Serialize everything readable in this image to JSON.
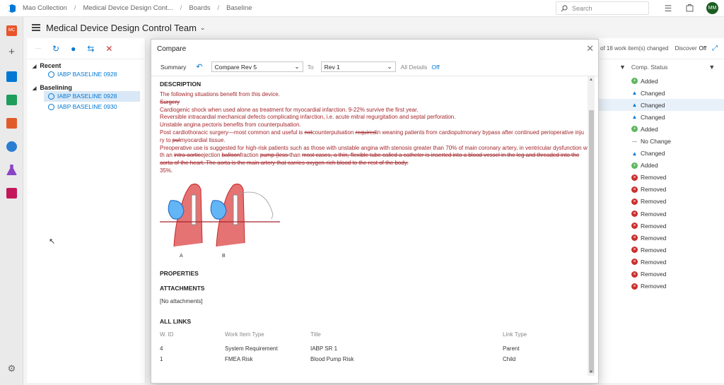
{
  "breadcrumbs": [
    "Mao Collection",
    "Medical Device Design Cont...",
    "Boards",
    "Baseline"
  ],
  "search_placeholder": "Search",
  "avatar": "MM",
  "rail_org_badge": "MC",
  "team_title": "Medical Device Design Control Team",
  "tree": {
    "recent_label": "Recent",
    "recent_items": [
      "IABP BASELINE 0928"
    ],
    "baselining_label": "Baselining",
    "baselining_items": [
      "IABP BASELINE 0928",
      "IABP BASELINE 0930"
    ]
  },
  "right_panel": {
    "summary": "of 18 work item(s) changed",
    "discover_label": "Discover",
    "discover_value": "Off",
    "col_header": "Comp. Status",
    "statuses": [
      "Added",
      "Changed",
      "Changed",
      "Changed",
      "Added",
      "No Change",
      "Changed",
      "Added",
      "Removed",
      "Removed",
      "Removed",
      "Removed",
      "Removed",
      "Removed",
      "Removed",
      "Removed",
      "Removed",
      "Removed"
    ]
  },
  "dialog": {
    "title": "Compare",
    "summary_tab": "Summary",
    "from_value": "Compare Rev 5",
    "to_label": "To",
    "to_value": "Rev 1",
    "all_details_label": "All Details",
    "all_details_value": "Off",
    "description_header": "DESCRIPTION",
    "desc_lines": {
      "l1": "The following situations benefit from this device.",
      "l2": "Surgery",
      "l3": "Cardiogenic shock when used alone as treatment for myocardial infarction. 9-22% survive the first year.",
      "l4": "Reversible intracardial mechanical defects complicating infarction, i.e. acute mitral regurgitation and septal perforation.",
      "l5": "Unstable angina pectoris benefits from counterpulsation.",
      "l6a": "Post cardiothoracic surgery—most common and useful is ",
      "l6b": "not",
      "l6c": "counterpulsation ",
      "l6d": "required",
      "l6e": "in weaning patients from cardiopulmonary bypass after continued perioperative inju",
      "l7a": "ry to ",
      "l7b": "pul",
      "l7c": "myocardial tissue.",
      "l8": "Preoperative use is suggested for high-risk patients such as those with unstable angina with stenosis greater than 70% of main coronary artery, in ventricular dysfunction w",
      "l9a": "th an ",
      "l9b": "intra-aortic",
      "l9c": "ejection ",
      "l9d": "balloon",
      "l9e": "fraction ",
      "l9f": "pump (less ",
      "l9g": "than ",
      "l9h": "most cases, a thin, flexible tube called a catheter is inserted into a blood vessel in the leg and threaded into the",
      "l10": "aorta of the heart. The aorta is the main artery that carries oxygen-rich blood to the rest of the body.",
      "l11": "35%."
    },
    "figure_labels": [
      "A",
      "B"
    ],
    "properties_header": "PROPERTIES",
    "attachments_header": "ATTACHMENTS",
    "no_attachments": "[No attachments]",
    "links_header": "ALL LINKS",
    "links_columns": [
      "W. ID",
      "Work Item Type",
      "Title",
      "Link Type"
    ],
    "links_rows": [
      {
        "id": "4",
        "type": "System Requirement",
        "title": "IABP SR 1",
        "link": "Parent"
      },
      {
        "id": "1",
        "type": "FMEA Risk",
        "title": "Blood Pump Risk",
        "link": "Child"
      }
    ]
  }
}
